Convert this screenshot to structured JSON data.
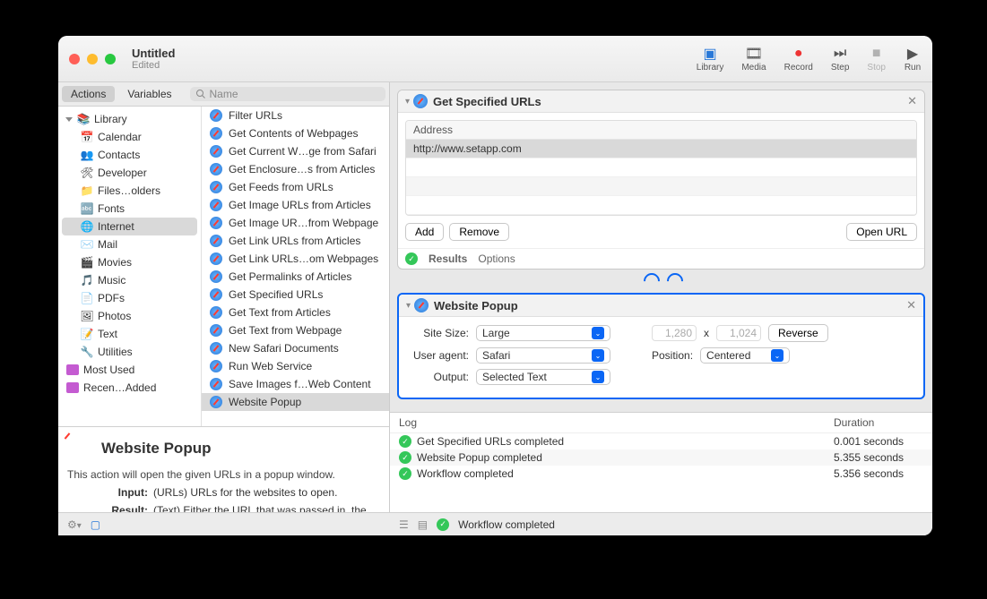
{
  "window": {
    "title": "Untitled",
    "subtitle": "Edited"
  },
  "toolbar": {
    "library": "Library",
    "media": "Media",
    "record": "Record",
    "step": "Step",
    "stop": "Stop",
    "run": "Run"
  },
  "tabs": {
    "actions": "Actions",
    "variables": "Variables",
    "search_placeholder": "Name"
  },
  "library": {
    "root": "Library",
    "items": [
      "Calendar",
      "Contacts",
      "Developer",
      "Files…olders",
      "Fonts",
      "Internet",
      "Mail",
      "Movies",
      "Music",
      "PDFs",
      "Photos",
      "Text",
      "Utilities"
    ],
    "extra": [
      "Most Used",
      "Recen…Added"
    ]
  },
  "actions": {
    "list": [
      "Filter URLs",
      "Get Contents of Webpages",
      "Get Current W…ge from Safari",
      "Get Enclosure…s from Articles",
      "Get Feeds from URLs",
      "Get Image URLs from Articles",
      "Get Image UR…from Webpage",
      "Get Link URLs from Articles",
      "Get Link URLs…om Webpages",
      "Get Permalinks of Articles",
      "Get Specified URLs",
      "Get Text from Articles",
      "Get Text from Webpage",
      "New Safari Documents",
      "Run Web Service",
      "Save Images f…Web Content",
      "Website Popup"
    ],
    "selected": "Website Popup"
  },
  "description": {
    "title": "Website Popup",
    "text": "This action will open the given URLs in a popup window.",
    "input_label": "Input:",
    "input_value": "(URLs) URLs for the websites to open.",
    "result_label": "Result:",
    "result_value": "(Text) Either the URL that was passed in, the last URL browsed to, or the selected text from the"
  },
  "workflow": {
    "card1": {
      "title": "Get Specified URLs",
      "address_header": "Address",
      "address_value": "http://www.setapp.com",
      "add": "Add",
      "remove": "Remove",
      "open": "Open URL",
      "results": "Results",
      "options": "Options"
    },
    "card2": {
      "title": "Website Popup",
      "site_size_label": "Site Size:",
      "site_size_value": "Large",
      "width": "1,280",
      "height": "1,024",
      "x": "x",
      "reverse": "Reverse",
      "user_agent_label": "User agent:",
      "user_agent_value": "Safari",
      "position_label": "Position:",
      "position_value": "Centered",
      "output_label": "Output:",
      "output_value": "Selected Text"
    }
  },
  "log": {
    "col1": "Log",
    "col2": "Duration",
    "rows": [
      {
        "msg": "Get Specified URLs completed",
        "dur": "0.001 seconds"
      },
      {
        "msg": "Website Popup completed",
        "dur": "5.355 seconds"
      },
      {
        "msg": "Workflow completed",
        "dur": "5.356 seconds"
      }
    ]
  },
  "statusbar": {
    "msg": "Workflow completed"
  }
}
